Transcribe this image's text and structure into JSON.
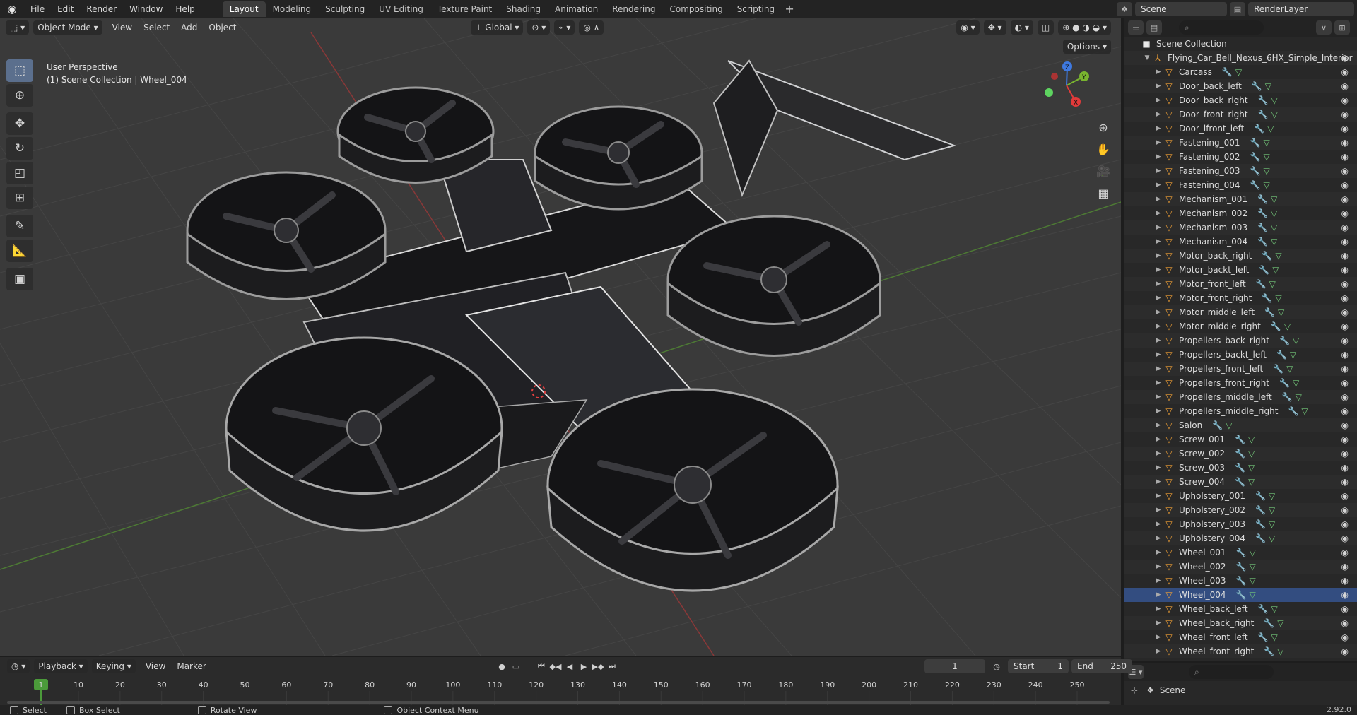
{
  "topbar": {
    "menus": [
      "File",
      "Edit",
      "Render",
      "Window",
      "Help"
    ],
    "workspaces": [
      "Layout",
      "Modeling",
      "Sculpting",
      "UV Editing",
      "Texture Paint",
      "Shading",
      "Animation",
      "Rendering",
      "Compositing",
      "Scripting"
    ],
    "active_workspace": "Layout",
    "add_tab": "+",
    "scene": "Scene",
    "view_layer": "RenderLayer"
  },
  "viewport": {
    "mode": "Object Mode",
    "menus": [
      "View",
      "Select",
      "Add",
      "Object"
    ],
    "orientation": "Global",
    "options_label": "Options",
    "info_line1": "User Perspective",
    "info_line2": "(1) Scene Collection | Wheel_004",
    "gizmo": {
      "x": "X",
      "y": "Y",
      "z": "Z"
    }
  },
  "outliner": {
    "search_placeholder": "",
    "scene_collection": "Scene Collection",
    "collection": "Flying_Car_Bell_Nexus_6HX_Simple_Interior",
    "selected": "Wheel_004",
    "objects": [
      "Carcass",
      "Door_back_left",
      "Door_back_right",
      "Door_front_right",
      "Door_lfront_left",
      "Fastening_001",
      "Fastening_002",
      "Fastening_003",
      "Fastening_004",
      "Mechanism_001",
      "Mechanism_002",
      "Mechanism_003",
      "Mechanism_004",
      "Motor_back_right",
      "Motor_backt_left",
      "Motor_front_left",
      "Motor_front_right",
      "Motor_middle_left",
      "Motor_middle_right",
      "Propellers_back_right",
      "Propellers_backt_left",
      "Propellers_front_left",
      "Propellers_front_right",
      "Propellers_middle_left",
      "Propellers_middle_right",
      "Salon",
      "Screw_001",
      "Screw_002",
      "Screw_003",
      "Screw_004",
      "Upholstery_001",
      "Upholstery_002",
      "Upholstery_003",
      "Upholstery_004",
      "Wheel_001",
      "Wheel_002",
      "Wheel_003",
      "Wheel_004",
      "Wheel_back_left",
      "Wheel_back_right",
      "Wheel_front_left",
      "Wheel_front_right"
    ]
  },
  "props": {
    "scene": "Scene"
  },
  "timeline": {
    "menus": [
      "Playback",
      "Keying",
      "View",
      "Marker"
    ],
    "current_frame": "1",
    "start_label": "Start",
    "start": "1",
    "end_label": "End",
    "end": "250",
    "ticks": [
      "1",
      "10",
      "20",
      "30",
      "40",
      "50",
      "60",
      "70",
      "80",
      "90",
      "100",
      "110",
      "120",
      "130",
      "140",
      "150",
      "160",
      "170",
      "180",
      "190",
      "200",
      "210",
      "220",
      "230",
      "240",
      "250"
    ]
  },
  "statusbar": {
    "select": "Select",
    "box_select": "Box Select",
    "rotate_view": "Rotate View",
    "context_menu": "Object Context Menu",
    "version": "2.92.0"
  },
  "colors": {
    "accent": "#5b6f8d",
    "selected_row": "#334d80",
    "object_icon": "#f0a036",
    "mesh_icon": "#74c97a",
    "modifier_icon": "#7aa6e0",
    "axis_x": "#e23a3a",
    "axis_y": "#79b42f",
    "axis_z": "#3e79e0"
  }
}
